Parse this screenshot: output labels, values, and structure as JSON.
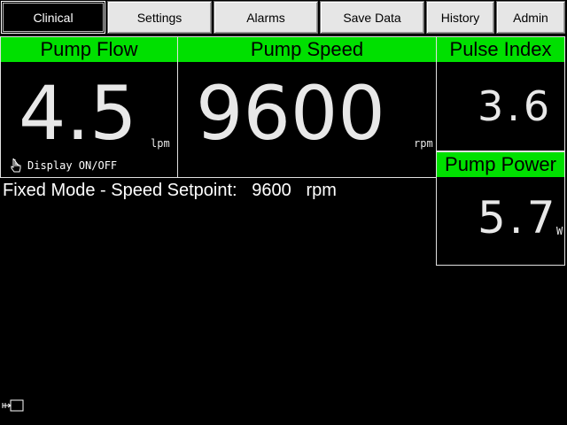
{
  "tabs": [
    {
      "label": "Clinical",
      "active": true
    },
    {
      "label": "Settings"
    },
    {
      "label": "Alarms"
    },
    {
      "label": "Save Data"
    },
    {
      "label": "History"
    },
    {
      "label": "Admin"
    }
  ],
  "pump_flow": {
    "title": "Pump Flow",
    "value": "4.5",
    "unit": "lpm",
    "display_toggle": "Display ON/OFF"
  },
  "pump_speed": {
    "title": "Pump Speed",
    "value": "9600",
    "unit": "rpm"
  },
  "pulse_index": {
    "title": "Pulse Index",
    "value": "3.6"
  },
  "pump_power": {
    "title": "Pump Power",
    "value": "5.7",
    "unit": "W"
  },
  "status": {
    "mode_text": "Fixed Mode - Speed Setpoint:",
    "setpoint": "9600",
    "unit": "rpm"
  },
  "colors": {
    "header_green": "#00e000",
    "background": "#000000",
    "tab_gray": "#e6e6e6"
  },
  "icons": {
    "toggle": "hand-pointer-icon",
    "corner": "plug-screen-icon"
  }
}
